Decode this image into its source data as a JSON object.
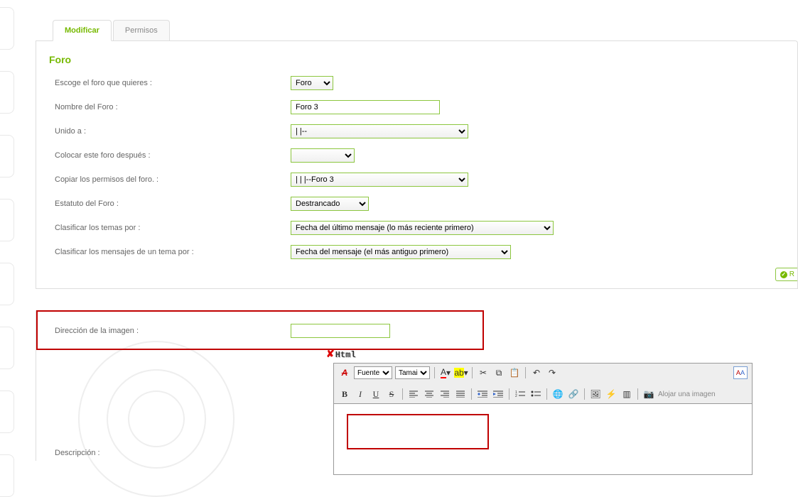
{
  "tabs": {
    "modificar": "Modificar",
    "permisos": "Permisos"
  },
  "panel": {
    "title": "Foro",
    "rows": {
      "escoge": {
        "label": "Escoge el foro que quieres :",
        "value": "Foro"
      },
      "nombre": {
        "label": "Nombre del Foro :",
        "value": "Foro 3"
      },
      "unido": {
        "label": "Unido a :",
        "value": "|   |--"
      },
      "colocar": {
        "label": "Colocar este foro después :",
        "value": ""
      },
      "copiar": {
        "label": "Copiar los permisos del foro. :",
        "value": "|   |   |--Foro 3"
      },
      "estatuto": {
        "label": "Estatuto del Foro :",
        "value": "Destrancado"
      },
      "clasificar_temas": {
        "label": "Clasificar los temas por :",
        "value": "Fecha del último mensaje (lo más reciente primero)"
      },
      "clasificar_mensajes": {
        "label": "Clasificar los mensajes de un tema por :",
        "value": "Fecha del mensaje (el más antiguo primero)"
      }
    },
    "status": "R"
  },
  "section2": {
    "direccion": {
      "label": "Dirección de la imagen :",
      "value": ""
    },
    "html_badge": "Html",
    "descripcion_label": "Descripción :",
    "editor": {
      "font_label": "Fuente",
      "size_label": "Tamai",
      "upload_text": "Alojar una imagen"
    }
  }
}
